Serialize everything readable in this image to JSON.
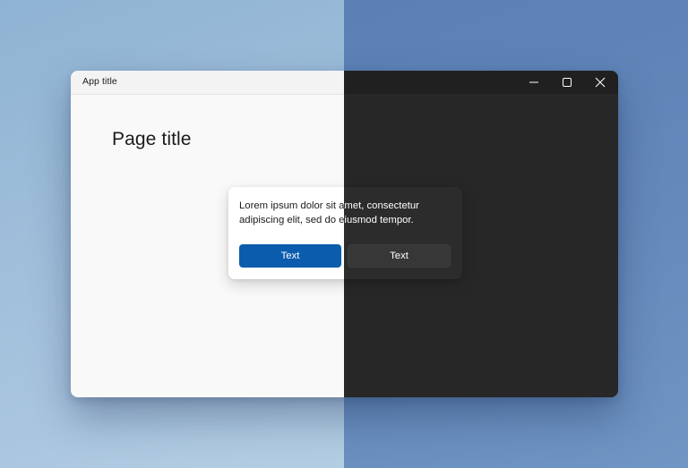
{
  "window": {
    "app_title": "App title"
  },
  "caption_buttons": {
    "minimize_icon": "minimize-icon",
    "maximize_icon": "maximize-icon",
    "close_icon": "close-icon"
  },
  "page": {
    "title": "Page title"
  },
  "dialog": {
    "body": "Lorem ipsum dolor sit amet, consectetur adipiscing elit, sed do eiusmod tempor.",
    "primary_button": "Text",
    "secondary_button": "Text"
  },
  "colors": {
    "accent": "#0b5cad",
    "light_surface": "#f9f9f9",
    "dark_surface": "#272727"
  }
}
